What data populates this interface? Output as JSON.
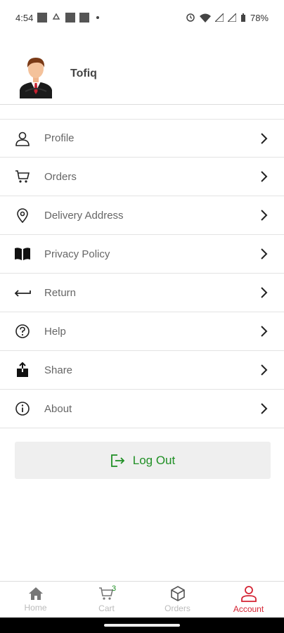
{
  "status_bar": {
    "time": "4:54",
    "battery": "78%"
  },
  "profile": {
    "name": "Tofiq"
  },
  "menu": {
    "items": [
      {
        "label": "Profile",
        "icon": "person-icon"
      },
      {
        "label": "Orders",
        "icon": "cart-icon"
      },
      {
        "label": "Delivery Address",
        "icon": "location-pin-icon"
      },
      {
        "label": "Privacy Policy",
        "icon": "book-icon"
      },
      {
        "label": "Return",
        "icon": "return-arrow-icon"
      },
      {
        "label": "Help",
        "icon": "help-icon"
      },
      {
        "label": "Share",
        "icon": "share-icon"
      },
      {
        "label": "About",
        "icon": "info-icon"
      }
    ]
  },
  "logout": {
    "label": "Log Out"
  },
  "bottom_nav": {
    "items": [
      {
        "label": "Home",
        "icon": "home-icon"
      },
      {
        "label": "Cart",
        "icon": "cart-icon",
        "badge": "3"
      },
      {
        "label": "Orders",
        "icon": "box-icon"
      },
      {
        "label": "Account",
        "icon": "account-icon",
        "active": true
      }
    ]
  },
  "colors": {
    "accent_green": "#1f8f24",
    "accent_red": "#d42333"
  }
}
